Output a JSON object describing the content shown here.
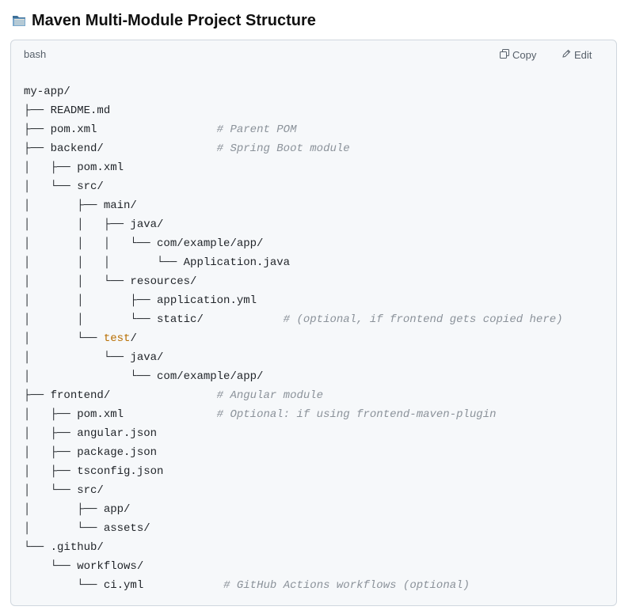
{
  "page": {
    "title": "Maven Multi-Module Project Structure",
    "icon": "folder-icon"
  },
  "code_block": {
    "language": "bash",
    "copy_label": "Copy",
    "edit_label": "Edit",
    "copy_icon": "copy-icon",
    "edit_icon": "pencil-icon",
    "colors": {
      "comment": "#8b929a",
      "highlight": "#b86e00",
      "background": "#f6f8fa",
      "border": "#d0d7de"
    },
    "lines": [
      {
        "prefix": "",
        "name": "my-app/",
        "suffix": "",
        "pad": "",
        "comment": ""
      },
      {
        "prefix": "├── ",
        "name": "README.md",
        "suffix": "",
        "pad": "",
        "comment": ""
      },
      {
        "prefix": "├── ",
        "name": "pom.xml",
        "suffix": "",
        "pad": "                  ",
        "comment": "# Parent POM"
      },
      {
        "prefix": "├── ",
        "name": "backend/",
        "suffix": "",
        "pad": "                 ",
        "comment": "# Spring Boot module"
      },
      {
        "prefix": "│   ├── ",
        "name": "pom.xml",
        "suffix": "",
        "pad": "",
        "comment": ""
      },
      {
        "prefix": "│   └── ",
        "name": "src/",
        "suffix": "",
        "pad": "",
        "comment": ""
      },
      {
        "prefix": "│       ├── ",
        "name": "main/",
        "suffix": "",
        "pad": "",
        "comment": ""
      },
      {
        "prefix": "│       │   ├── ",
        "name": "java/",
        "suffix": "",
        "pad": "",
        "comment": ""
      },
      {
        "prefix": "│       │   │   └── ",
        "name": "com/example/app/",
        "suffix": "",
        "pad": "",
        "comment": ""
      },
      {
        "prefix": "│       │   │       └── ",
        "name": "Application.java",
        "suffix": "",
        "pad": "",
        "comment": ""
      },
      {
        "prefix": "│       │   └── ",
        "name": "resources/",
        "suffix": "",
        "pad": "",
        "comment": ""
      },
      {
        "prefix": "│       │       ├── ",
        "name": "application.yml",
        "suffix": "",
        "pad": "",
        "comment": ""
      },
      {
        "prefix": "│       │       └── ",
        "name": "static/",
        "suffix": "",
        "pad": "            ",
        "comment": "# (optional, if frontend gets copied here)"
      },
      {
        "prefix": "│       └── ",
        "highlight": "test",
        "name": "",
        "suffix": "/",
        "pad": "",
        "comment": ""
      },
      {
        "prefix": "│           └── ",
        "name": "java/",
        "suffix": "",
        "pad": "",
        "comment": ""
      },
      {
        "prefix": "│               └── ",
        "name": "com/example/app/",
        "suffix": "",
        "pad": "",
        "comment": ""
      },
      {
        "prefix": "├── ",
        "name": "frontend/",
        "suffix": "",
        "pad": "                ",
        "comment": "# Angular module"
      },
      {
        "prefix": "│   ├── ",
        "name": "pom.xml",
        "suffix": "",
        "pad": "              ",
        "comment": "# Optional: if using frontend-maven-plugin"
      },
      {
        "prefix": "│   ├── ",
        "name": "angular.json",
        "suffix": "",
        "pad": "",
        "comment": ""
      },
      {
        "prefix": "│   ├── ",
        "name": "package.json",
        "suffix": "",
        "pad": "",
        "comment": ""
      },
      {
        "prefix": "│   ├── ",
        "name": "tsconfig.json",
        "suffix": "",
        "pad": "",
        "comment": ""
      },
      {
        "prefix": "│   └── ",
        "name": "src/",
        "suffix": "",
        "pad": "",
        "comment": ""
      },
      {
        "prefix": "│       ├── ",
        "name": "app/",
        "suffix": "",
        "pad": "",
        "comment": ""
      },
      {
        "prefix": "│       └── ",
        "name": "assets/",
        "suffix": "",
        "pad": "",
        "comment": ""
      },
      {
        "prefix": "└── ",
        "name": ".github/",
        "suffix": "",
        "pad": "",
        "comment": ""
      },
      {
        "prefix": "    └── ",
        "name": "workflows/",
        "suffix": "",
        "pad": "",
        "comment": ""
      },
      {
        "prefix": "        └── ",
        "name": "ci.yml",
        "suffix": "",
        "pad": "            ",
        "comment": "# GitHub Actions workflows (optional)"
      }
    ]
  }
}
